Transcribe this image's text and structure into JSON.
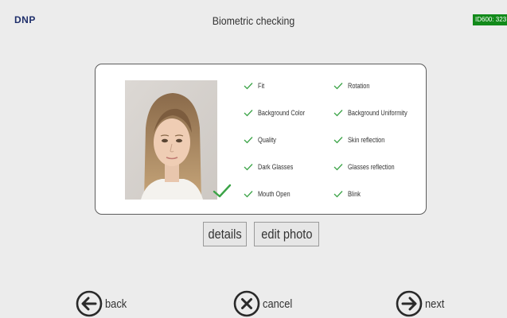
{
  "header": {
    "logo": "DNP",
    "title": "Biometric checking",
    "device_id": "ID600: 323"
  },
  "checks": {
    "left": [
      {
        "label": "Fit",
        "status": "pass"
      },
      {
        "label": "Background Color",
        "status": "pass"
      },
      {
        "label": "Quality",
        "status": "pass"
      },
      {
        "label": "Dark Glasses",
        "status": "pass"
      },
      {
        "label": "Mouth Open",
        "status": "pass"
      }
    ],
    "right": [
      {
        "label": "Rotation",
        "status": "pass"
      },
      {
        "label": "Background Uniformity",
        "status": "pass"
      },
      {
        "label": "Skin reflection",
        "status": "pass"
      },
      {
        "label": "Glasses reflection",
        "status": "pass"
      },
      {
        "label": "Blink",
        "status": "pass"
      }
    ]
  },
  "photo_status": "pass",
  "actions": {
    "details_label": "details",
    "edit_photo_label": "edit photo"
  },
  "nav": {
    "back_label": "back",
    "cancel_label": "cancel",
    "next_label": "next"
  },
  "icons": {
    "check": "check-icon",
    "back": "arrow-left-circle-icon",
    "cancel": "x-circle-icon",
    "next": "arrow-right-circle-icon"
  },
  "colors": {
    "background": "#ececec",
    "check_green": "#3aa346",
    "id_badge": "#128a1a",
    "logo_blue": "#1f2f6b"
  }
}
